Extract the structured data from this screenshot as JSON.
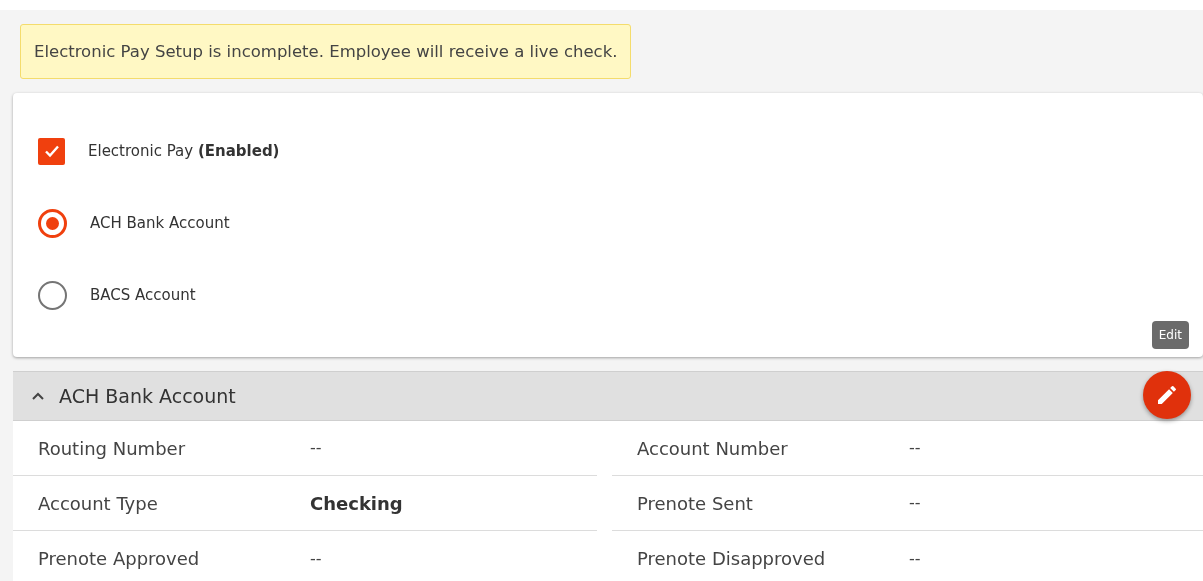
{
  "alert": {
    "text": "Electronic Pay Setup is incomplete. Employee will receive a live check."
  },
  "options": [
    {
      "kind": "checkbox",
      "label": "Electronic Pay **(Enabled)**",
      "checked": true
    },
    {
      "kind": "radio",
      "label": "ACH Bank Account",
      "selected": true
    },
    {
      "kind": "radio",
      "label": "BACS Account",
      "selected": false
    }
  ],
  "edit_tooltip": "Edit",
  "section": {
    "title": "ACH Bank Account",
    "expanded": true,
    "columns": [
      [
        {
          "label": "Routing Number",
          "value": "--",
          "emphasis": false
        },
        {
          "label": "Account Type",
          "value": "Checking",
          "emphasis": true
        },
        {
          "label": "Prenote Approved",
          "value": "--",
          "emphasis": false
        }
      ],
      [
        {
          "label": "Account Number",
          "value": "--",
          "emphasis": false
        },
        {
          "label": "Prenote Sent",
          "value": "--",
          "emphasis": false
        },
        {
          "label": "Prenote Disapproved",
          "value": "--",
          "emphasis": false
        }
      ]
    ]
  }
}
